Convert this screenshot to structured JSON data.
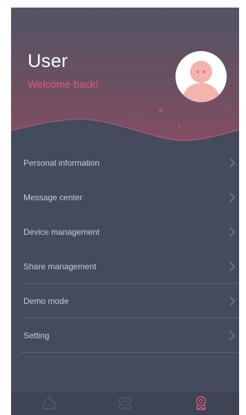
{
  "header": {
    "title": "User",
    "subtitle": "Welcome back!"
  },
  "menu": {
    "items": [
      {
        "label": "Personal information",
        "name": "menu-personal-information"
      },
      {
        "label": "Message center",
        "name": "menu-message-center"
      },
      {
        "label": "Device management",
        "name": "menu-device-management"
      },
      {
        "label": "Share management",
        "name": "menu-share-management"
      },
      {
        "label": "Demo mode",
        "name": "menu-demo-mode"
      },
      {
        "label": "Setting",
        "name": "menu-setting"
      }
    ]
  },
  "tabbar": {
    "tabs": [
      {
        "icon": "home-icon",
        "active": false
      },
      {
        "icon": "grid-icon",
        "active": false
      },
      {
        "icon": "profile-badge-icon",
        "active": true
      }
    ]
  },
  "colors": {
    "background": "#444b5f",
    "accent": "#e35a73",
    "header_gradient_top": "#545463",
    "header_gradient_bottom": "#7a4e63"
  }
}
